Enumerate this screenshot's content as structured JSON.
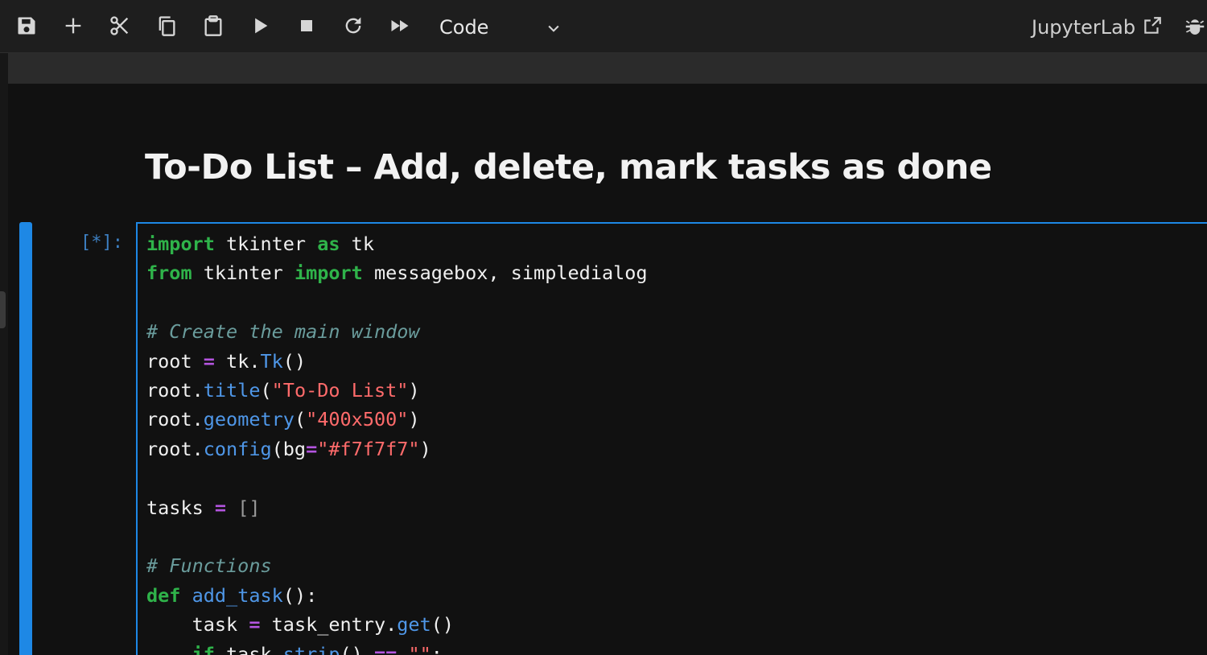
{
  "toolbar": {
    "icons": [
      "save-icon",
      "plus-icon",
      "scissors-icon",
      "copy-icon",
      "paste-icon",
      "run-icon",
      "stop-icon",
      "restart-icon",
      "fast-forward-icon"
    ],
    "cell_type": "Code",
    "app_link": "JupyterLab"
  },
  "notebook": {
    "heading": "To-Do List – Add, delete, mark tasks as done",
    "cell": {
      "prompt": "[*]:",
      "lines": [
        [
          {
            "t": "kw",
            "v": "import"
          },
          {
            "t": "nm",
            "v": " tkinter "
          },
          {
            "t": "kw",
            "v": "as"
          },
          {
            "t": "nm",
            "v": " tk"
          }
        ],
        [
          {
            "t": "kw",
            "v": "from"
          },
          {
            "t": "nm",
            "v": " tkinter "
          },
          {
            "t": "kw",
            "v": "import"
          },
          {
            "t": "nm",
            "v": " messagebox, simpledialog"
          }
        ],
        [],
        [
          {
            "t": "cm",
            "v": "# Create the main window"
          }
        ],
        [
          {
            "t": "nm",
            "v": "root "
          },
          {
            "t": "op",
            "v": "="
          },
          {
            "t": "nm",
            "v": " tk."
          },
          {
            "t": "fn",
            "v": "Tk"
          },
          {
            "t": "nm",
            "v": "()"
          }
        ],
        [
          {
            "t": "nm",
            "v": "root."
          },
          {
            "t": "fn",
            "v": "title"
          },
          {
            "t": "nm",
            "v": "("
          },
          {
            "t": "st",
            "v": "\"To-Do List\""
          },
          {
            "t": "nm",
            "v": ")"
          }
        ],
        [
          {
            "t": "nm",
            "v": "root."
          },
          {
            "t": "fn",
            "v": "geometry"
          },
          {
            "t": "nm",
            "v": "("
          },
          {
            "t": "st",
            "v": "\"400x500\""
          },
          {
            "t": "nm",
            "v": ")"
          }
        ],
        [
          {
            "t": "nm",
            "v": "root."
          },
          {
            "t": "fn",
            "v": "config"
          },
          {
            "t": "nm",
            "v": "(bg"
          },
          {
            "t": "op",
            "v": "="
          },
          {
            "t": "st",
            "v": "\"#f7f7f7\""
          },
          {
            "t": "nm",
            "v": ")"
          }
        ],
        [],
        [
          {
            "t": "nm",
            "v": "tasks "
          },
          {
            "t": "op",
            "v": "="
          },
          {
            "t": "nm",
            "v": " "
          },
          {
            "t": "br",
            "v": "[]"
          }
        ],
        [],
        [
          {
            "t": "cm",
            "v": "# Functions"
          }
        ],
        [
          {
            "t": "kw",
            "v": "def"
          },
          {
            "t": "nm",
            "v": " "
          },
          {
            "t": "fn",
            "v": "add_task"
          },
          {
            "t": "nm",
            "v": "():"
          }
        ],
        [
          {
            "t": "nm",
            "v": "    task "
          },
          {
            "t": "op",
            "v": "="
          },
          {
            "t": "nm",
            "v": " task_entry."
          },
          {
            "t": "fn",
            "v": "get"
          },
          {
            "t": "nm",
            "v": "()"
          }
        ],
        [
          {
            "t": "nm",
            "v": "    "
          },
          {
            "t": "kw",
            "v": "if"
          },
          {
            "t": "nm",
            "v": " task."
          },
          {
            "t": "fn",
            "v": "strip"
          },
          {
            "t": "nm",
            "v": "() "
          },
          {
            "t": "op",
            "v": "=="
          },
          {
            "t": "nm",
            "v": " "
          },
          {
            "t": "st",
            "v": "\"\""
          },
          {
            "t": "nm",
            "v": ":"
          }
        ]
      ]
    }
  },
  "colors": {
    "accent": "#1e88e5",
    "keyword": "#2fb34a",
    "function": "#4f97e8",
    "string": "#ff6b6b",
    "comment": "#6a9c9c",
    "operator": "#b455e0"
  }
}
